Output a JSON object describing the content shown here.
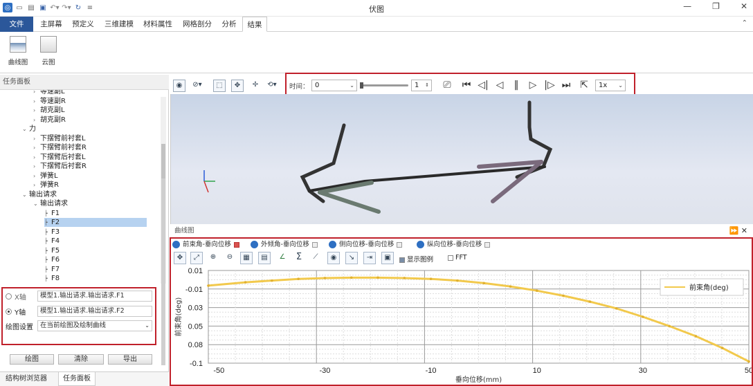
{
  "app": {
    "title": "伏图"
  },
  "quick_access": [
    "app-icon",
    "new-icon",
    "open-icon",
    "save-icon",
    "undo-icon",
    "redo-icon",
    "refresh-icon"
  ],
  "ribbon_tabs": [
    {
      "label": "文件"
    },
    {
      "label": "主屏幕"
    },
    {
      "label": "预定义"
    },
    {
      "label": "三维建模"
    },
    {
      "label": "材料属性"
    },
    {
      "label": "网格剖分"
    },
    {
      "label": "分析"
    },
    {
      "label": "结果"
    }
  ],
  "ribbon_buttons": [
    {
      "label": "曲线图"
    },
    {
      "label": "云图"
    }
  ],
  "left_panel": {
    "title": "任务面板",
    "tree": [
      {
        "label": "等速副L",
        "arrow": "›"
      },
      {
        "label": "等速副R",
        "arrow": "›"
      },
      {
        "label": "胡克副L",
        "arrow": "›"
      },
      {
        "label": "胡克副R",
        "arrow": "›"
      },
      {
        "label": "力",
        "arrow": "⌄"
      },
      {
        "label": "下摆臂前衬套L",
        "arrow": "›"
      },
      {
        "label": "下摆臂前衬套R",
        "arrow": "›"
      },
      {
        "label": "下摆臂后衬套L",
        "arrow": "›"
      },
      {
        "label": "下摆臂后衬套R",
        "arrow": "›"
      },
      {
        "label": "弹簧L",
        "arrow": "›"
      },
      {
        "label": "弹簧R",
        "arrow": "›"
      },
      {
        "label": "输出请求",
        "arrow": "⌄"
      },
      {
        "label": "输出请求",
        "arrow": "⌄"
      },
      {
        "label": "F1",
        "arrow": ""
      },
      {
        "label": "F2",
        "arrow": ""
      },
      {
        "label": "F3",
        "arrow": ""
      },
      {
        "label": "F4",
        "arrow": ""
      },
      {
        "label": "F5",
        "arrow": ""
      },
      {
        "label": "F6",
        "arrow": ""
      },
      {
        "label": "F7",
        "arrow": ""
      },
      {
        "label": "F8",
        "arrow": ""
      }
    ],
    "x_axis": {
      "label": "X轴",
      "value": "模型1.输出请求.输出请求.F1"
    },
    "y_axis": {
      "label": "Y轴",
      "value": "模型1.输出请求.输出请求.F2"
    },
    "plot_setting": {
      "label": "绘图设置",
      "value": "在当前绘图及绘制曲线"
    },
    "buttons": {
      "plot": "绘图",
      "clear": "清除",
      "export": "导出"
    },
    "bottom_tabs": [
      "结构树浏览器",
      "任务面板"
    ]
  },
  "playback": {
    "time_label": "时间：",
    "time_value": "0",
    "frame_value": "1",
    "speed_value": "1x"
  },
  "curve_panel": {
    "title": "曲线图",
    "tabs": [
      "前束角-垂向位移",
      "外倾角-垂向位移",
      "侧向位移-垂向位移",
      "纵向位移-垂向位移"
    ],
    "show_legend_label": "显示图例",
    "fft_label": "FFT"
  },
  "chart_data": {
    "type": "line",
    "xlabel": "垂向位移(mm)",
    "ylabel": "前束角(deg)",
    "xlim": [
      -52,
      50
    ],
    "ylim": [
      -0.1,
      0.01
    ],
    "x_ticks": [
      "-50",
      "-30",
      "-10",
      "10",
      "30",
      "50"
    ],
    "y_ticks": [
      "0.01",
      "-0.01",
      "0.03",
      "0.05",
      "0.08",
      "-0.1"
    ],
    "legend_position": "top-right",
    "series": [
      {
        "name": "前束角(deg)",
        "color": "#f2c94c",
        "x": [
          -52,
          -45,
          -40,
          -35,
          -30,
          -25,
          -20,
          -15,
          -10,
          -5,
          0,
          5,
          10,
          15,
          20,
          25,
          30,
          35,
          40,
          45,
          50
        ],
        "y": [
          -0.008,
          -0.004,
          -0.002,
          0.0,
          0.001,
          0.0015,
          0.0015,
          0.001,
          0.0,
          -0.002,
          -0.005,
          -0.009,
          -0.014,
          -0.02,
          -0.027,
          -0.035,
          -0.045,
          -0.056,
          -0.068,
          -0.082,
          -0.098
        ]
      }
    ]
  }
}
